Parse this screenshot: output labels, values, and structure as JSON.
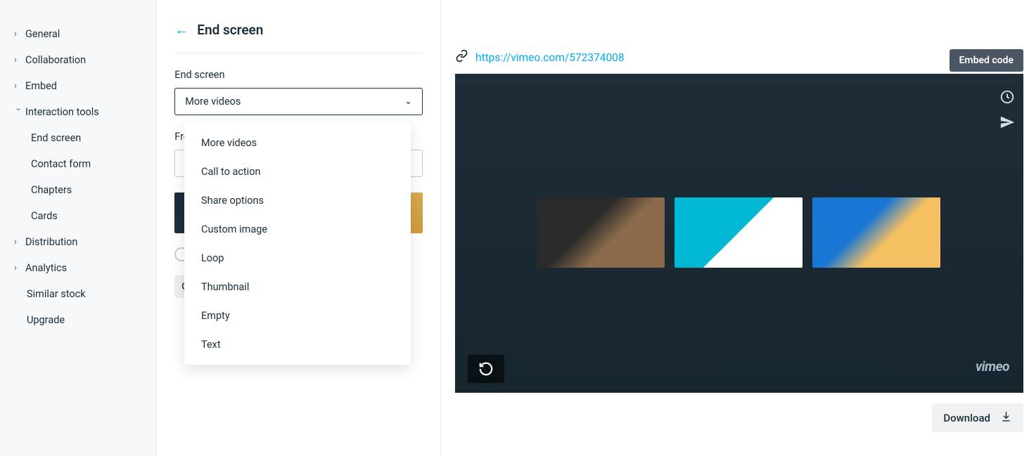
{
  "sidebar": {
    "items": [
      {
        "label": "General",
        "expanded": false
      },
      {
        "label": "Collaboration",
        "expanded": false
      },
      {
        "label": "Embed",
        "expanded": false
      },
      {
        "label": "Interaction tools",
        "expanded": true,
        "children": [
          {
            "label": "End screen"
          },
          {
            "label": "Contact form"
          },
          {
            "label": "Chapters"
          },
          {
            "label": "Cards"
          }
        ]
      },
      {
        "label": "Distribution",
        "expanded": false
      },
      {
        "label": "Analytics",
        "expanded": false
      }
    ],
    "similar_stock": "Similar stock",
    "upgrade": "Upgrade"
  },
  "panel": {
    "title": "End screen",
    "field_label": "End screen",
    "selected": "More videos",
    "from_label": "From",
    "dropdown_options": [
      "More videos",
      "Call to action",
      "Share options",
      "Custom image",
      "Loop",
      "Thumbnail",
      "Empty",
      "Text"
    ]
  },
  "preview": {
    "url": "https://vimeo.com/572374008",
    "embed_label": "Embed code",
    "logo": "vimeo",
    "download_label": "Download"
  }
}
